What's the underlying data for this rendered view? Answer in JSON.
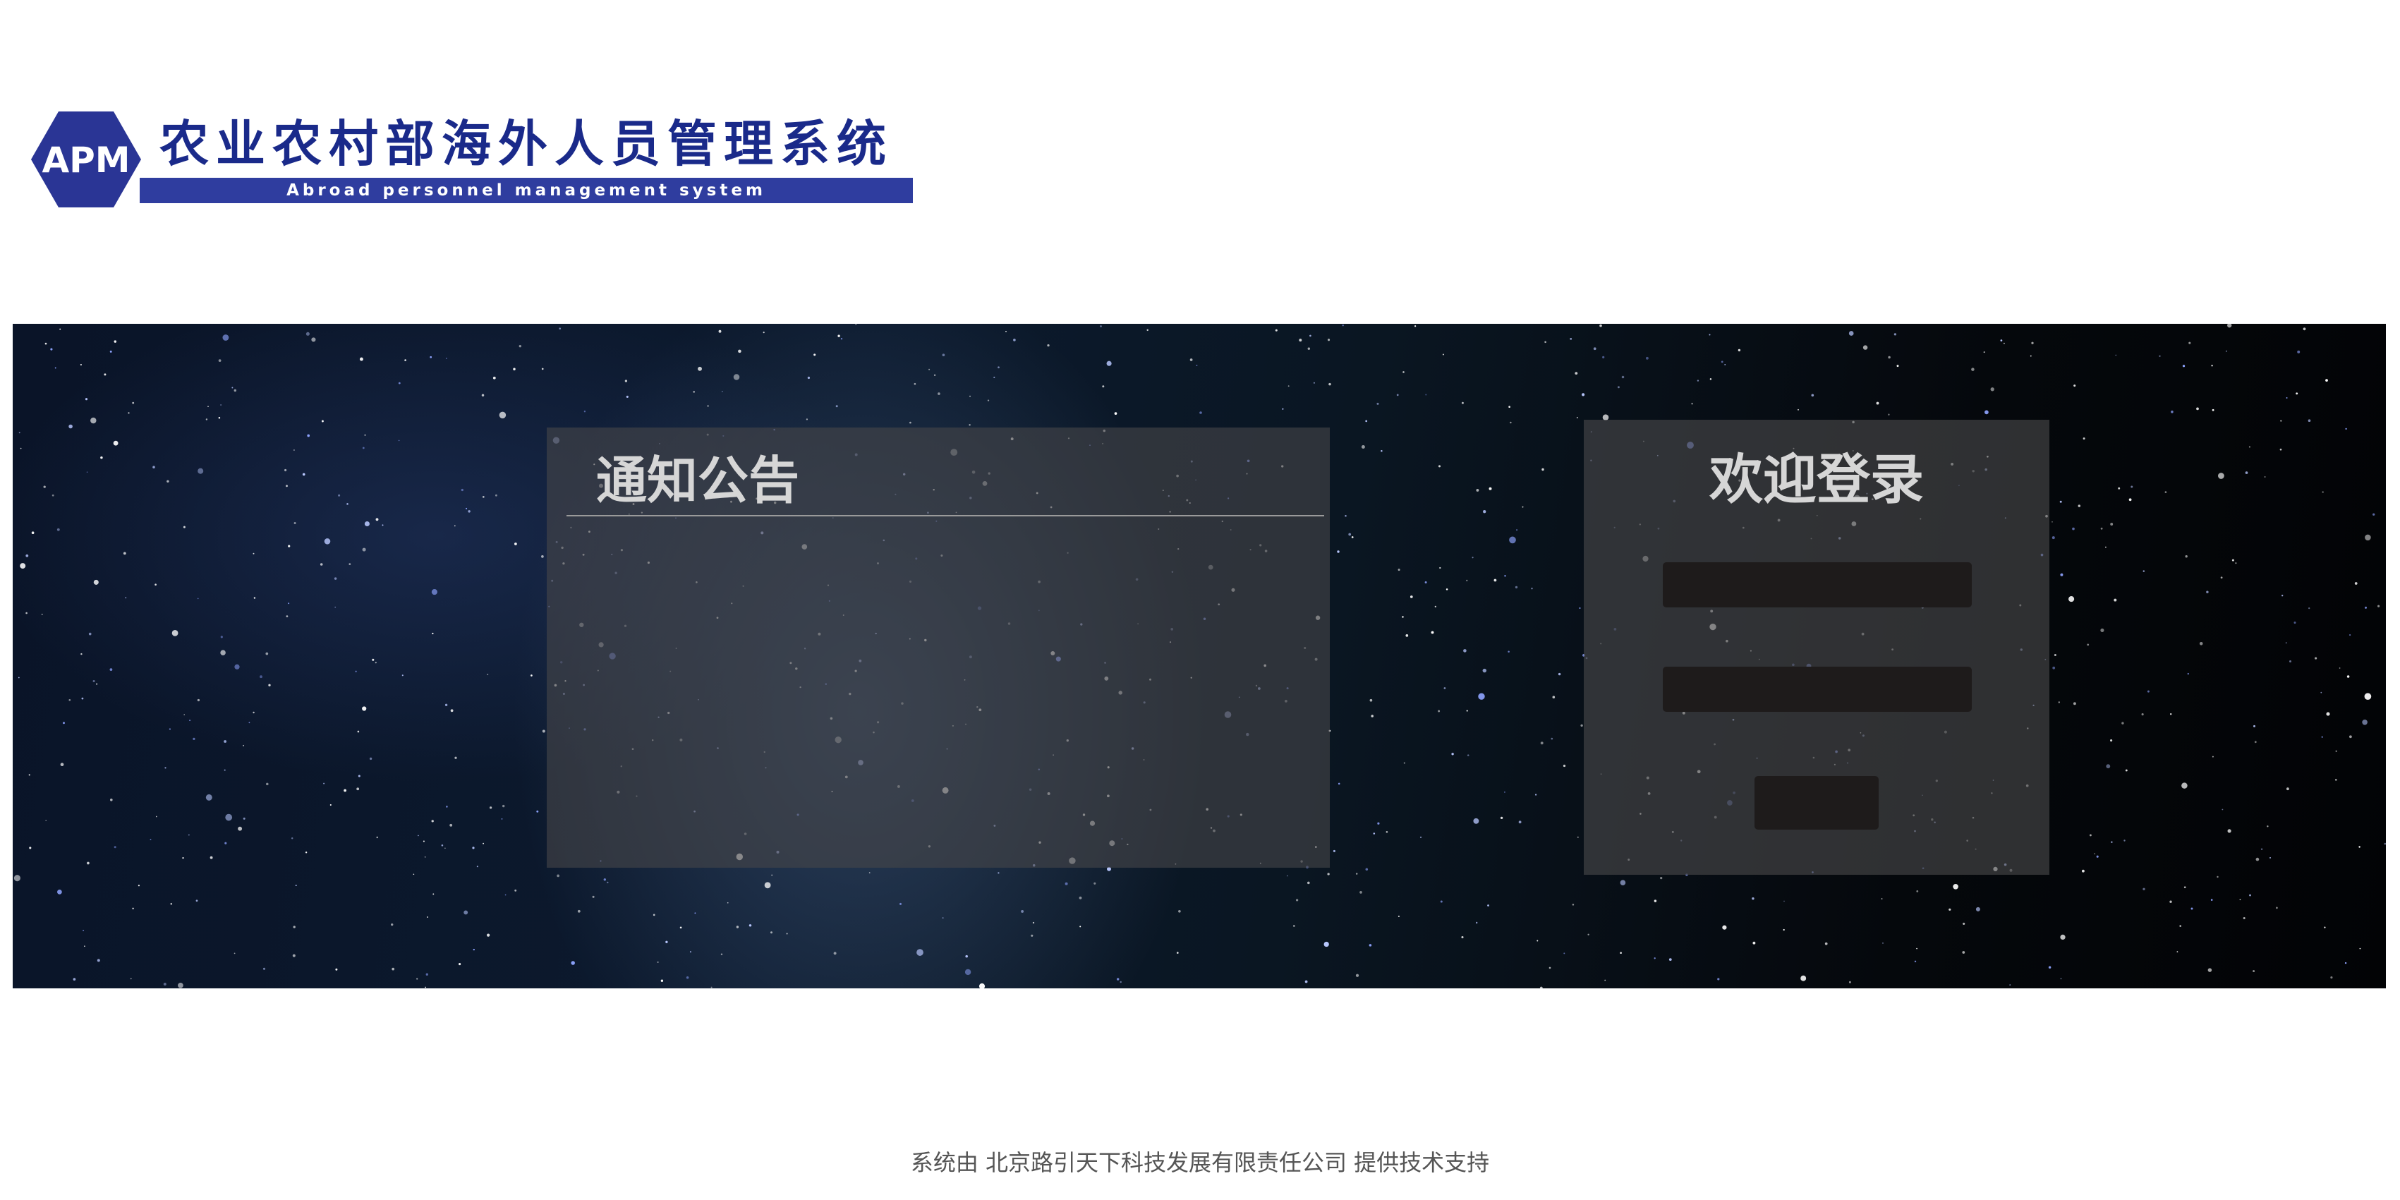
{
  "header": {
    "logo_abbr": "APM",
    "title": "农业农村部海外人员管理系统",
    "subtitle": "Abroad personnel management system"
  },
  "notice": {
    "title": "通知公告",
    "items": []
  },
  "login": {
    "title": "欢迎登录",
    "username": {
      "value": "",
      "placeholder": ""
    },
    "password": {
      "value": "",
      "placeholder": ""
    },
    "submit_label": ""
  },
  "footer": {
    "text": "系统由 北京路引天下科技发展有限责任公司  提供技术支持"
  },
  "colors": {
    "brand": "#1a2a8a",
    "brand_band": "#2f3d9f",
    "panel": "#464648",
    "input": "#1e1b1b"
  }
}
